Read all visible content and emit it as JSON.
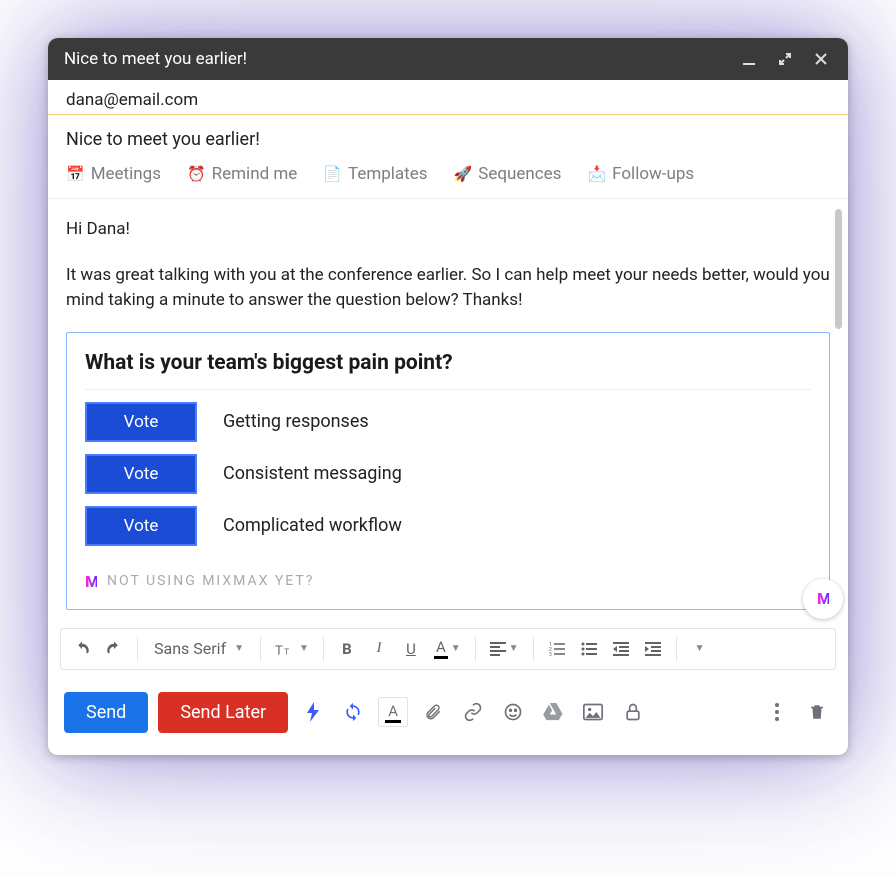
{
  "window": {
    "title": "Nice to meet you earlier!"
  },
  "to": "dana@email.com",
  "subject": "Nice to meet you earlier!",
  "enhancements": {
    "meetings": "Meetings",
    "remind": "Remind me",
    "templates": "Templates",
    "sequences": "Sequences",
    "followups": "Follow-ups"
  },
  "body": {
    "greeting": "Hi Dana!",
    "para1": "It was great talking with you at the conference earlier. So I can help meet your needs better, would you mind taking a minute to answer the question below? Thanks!"
  },
  "poll": {
    "question": "What is your team's biggest pain point?",
    "vote_label": "Vote",
    "options": [
      "Getting responses",
      "Consistent messaging",
      "Complicated workflow"
    ],
    "mixmax_cta": "Not using Mixmax yet?"
  },
  "toolbar": {
    "font_family": "Sans Serif"
  },
  "actions": {
    "send": "Send",
    "send_later": "Send Later"
  },
  "colors": {
    "primary_blue": "#1a73e8",
    "vote_blue": "#1a4cd6",
    "send_later_red": "#d93025"
  }
}
